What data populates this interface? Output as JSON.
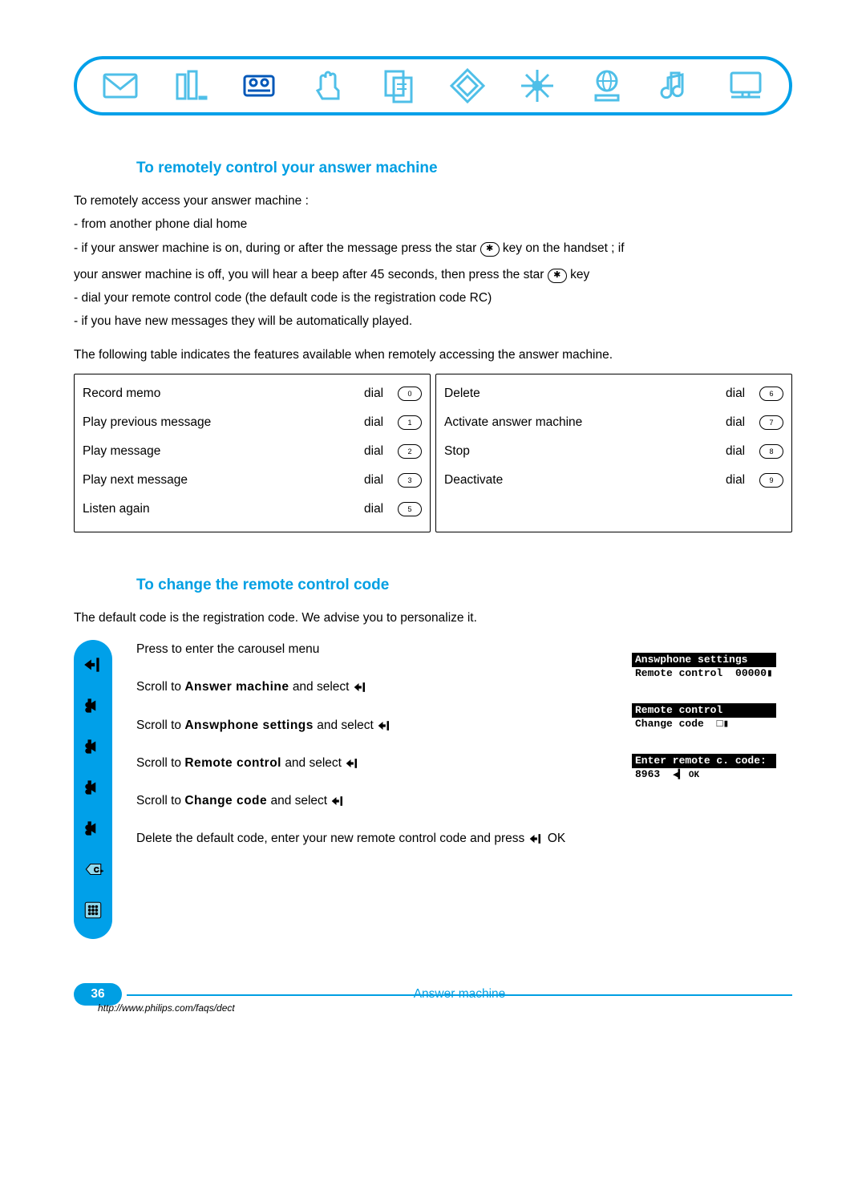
{
  "section1": {
    "heading": "To remotely control your answer machine",
    "intro": "To remotely access your answer machine :",
    "b1": "- from another phone dial home",
    "b2a": "- if your answer machine is on, during or after the message press the star ",
    "b2b": " key on the handset ; if",
    "b3a": "your answer machine is off, you will hear a beep after 45 seconds, then press the star ",
    "b3b": " key",
    "b4": "- dial your remote control code (the default code is the registration code RC)",
    "b5": "- if you have new messages they will be automatically played.",
    "tabledesc": "The following table indicates the features available when remotely accessing the answer machine."
  },
  "features": {
    "dial_word": "dial",
    "left": [
      {
        "label": "Record memo",
        "key": "0"
      },
      {
        "label": "Play previous message",
        "key": "1"
      },
      {
        "label": "Play message",
        "key": "2"
      },
      {
        "label": "Play next message",
        "key": "3"
      },
      {
        "label": "Listen again",
        "key": "5"
      }
    ],
    "right": [
      {
        "label": "Delete",
        "key": "6"
      },
      {
        "label": "Activate answer machine",
        "key": "7"
      },
      {
        "label": "Stop",
        "key": "8"
      },
      {
        "label": "Deactivate",
        "key": "9"
      }
    ]
  },
  "section2": {
    "heading": "To change the remote control code",
    "intro": "The default code is the registration code. We advise you to personalize it.",
    "steps": {
      "s1": "Press to enter the carousel menu",
      "s2a": "Scroll to ",
      "s2b": "Answer machine",
      "s2c": " and select ",
      "s3a": "Scroll to ",
      "s3b": "Answphone settings",
      "s3c": " and select ",
      "s4a": "Scroll to ",
      "s4b": "Remote control",
      "s4c": " and select ",
      "s5a": "Scroll to ",
      "s5b": "Change code",
      "s5c": " and select ",
      "s6a": "Delete the default code, enter your new remote control code and press ",
      "s6b": "OK"
    },
    "lcd": {
      "a1": "Answphone settings",
      "a2": "Remote control",
      "a3": "00000▮",
      "b1": "Remote control",
      "b2": "Change code",
      "b3": "□▮",
      "c1": "Enter remote c. code:",
      "c2": "8963",
      "c3": "◀▍ OK"
    }
  },
  "footer": {
    "page": "36",
    "title": "Answer machine",
    "url": "http://www.philips.com/faqs/dect"
  }
}
